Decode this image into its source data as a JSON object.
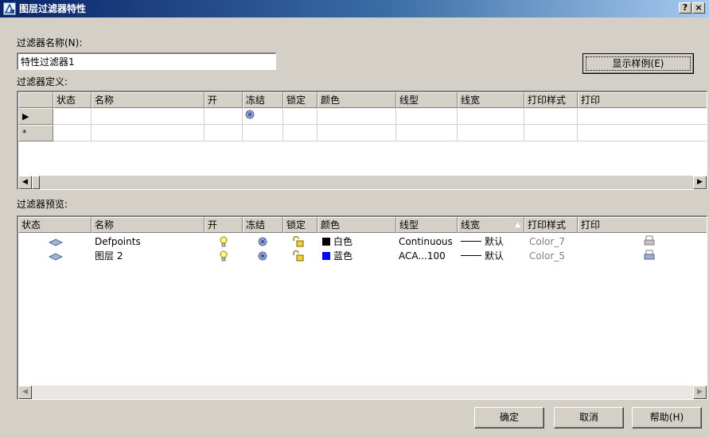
{
  "window": {
    "title": "图层过滤器特性",
    "help_btn": "?",
    "close_btn": "×"
  },
  "filter_name": {
    "label": "过滤器名称(N):",
    "value": "特性过滤器1"
  },
  "show_example_button": "显示样例(E)",
  "definition": {
    "label": "过滤器定义:",
    "columns": [
      "状态",
      "名称",
      "开",
      "冻结",
      "锁定",
      "颜色",
      "线型",
      "线宽",
      "打印样式",
      "打印"
    ],
    "rows": [
      {
        "marker": "▶",
        "freeze_icon": "freeze-icon"
      },
      {
        "marker": "*"
      }
    ]
  },
  "preview": {
    "label": "过滤器预览:",
    "columns": [
      "状态",
      "名称",
      "开",
      "冻结",
      "锁定",
      "颜色",
      "线型",
      "线宽",
      "打印样式",
      "打印"
    ],
    "rows": [
      {
        "name": "Defpoints",
        "color_name": "白色",
        "color_hex": "#000000",
        "linetype": "Continuous",
        "lineweight": "默认",
        "plot_style": "Color_7"
      },
      {
        "name": "图层 2",
        "color_name": "蓝色",
        "color_hex": "#0000ff",
        "linetype": "ACA...100",
        "lineweight": "默认",
        "plot_style": "Color_5"
      }
    ]
  },
  "buttons": {
    "ok": "确定",
    "cancel": "取消",
    "help": "帮助(H)"
  },
  "colors": {
    "title_start": "#0a246a",
    "title_end": "#a6caf0",
    "face": "#d4d0c8"
  }
}
